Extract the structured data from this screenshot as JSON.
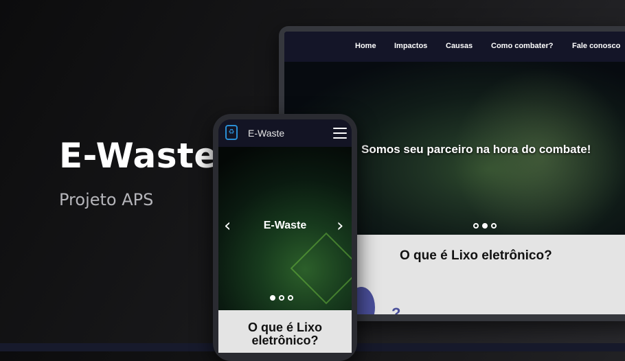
{
  "hero": {
    "title": "E-Waste",
    "subtitle": "Projeto APS"
  },
  "laptop": {
    "nav": {
      "items": [
        "Home",
        "Impactos",
        "Causas",
        "Como combater?",
        "Fale conosco"
      ]
    },
    "carousel": {
      "caption": "Somos seu parceiro na hora do combate!",
      "slide_count": 3,
      "active_index": 1
    },
    "section": {
      "title": "O que é Lixo eletrônico?",
      "partial_glyph": "?"
    }
  },
  "phone": {
    "header": {
      "brand": "E-Waste",
      "logo_icon": "recycle-icon",
      "menu_icon": "hamburger-icon"
    },
    "carousel": {
      "caption": "E-Waste",
      "prev_icon": "chevron-left-icon",
      "next_icon": "chevron-right-icon",
      "slide_count": 3,
      "active_index": 0
    },
    "section": {
      "title": "O que é Lixo eletrônico?"
    }
  },
  "colors": {
    "background": "#111113",
    "navbar": "#141528",
    "content_bg": "#e4e4e4",
    "accent_blue": "#2a8fd6",
    "accent_purple": "#4a4f9a"
  }
}
